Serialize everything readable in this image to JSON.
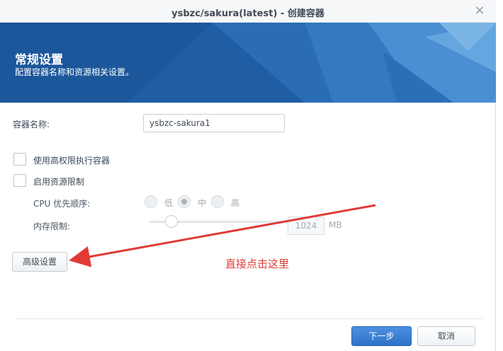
{
  "window": {
    "title": "ysbzc/sakura(latest) - 创建容器",
    "close_glyph": "×"
  },
  "banner": {
    "title": "常规设置",
    "subtitle": "配置容器名称和资源相关设置。"
  },
  "form": {
    "container_name_label": "容器名称:",
    "container_name_value": "ysbzc-sakura1",
    "privileged_label": "使用高权限执行容器",
    "privileged_checked": false,
    "resource_limit_label": "启用资源限制",
    "resource_limit_checked": false,
    "cpu_priority_label": "CPU 优先顺序:",
    "cpu_options": [
      "低",
      "中",
      "高"
    ],
    "cpu_selected": "中",
    "memory_limit_label": "内存限制:",
    "memory_value": "1024",
    "memory_unit": "MB"
  },
  "buttons": {
    "advanced": "高级设置",
    "next": "下一步",
    "cancel": "取消"
  },
  "annotation": {
    "text": "直接点击这里",
    "color": "#e03b36"
  },
  "colors": {
    "banner": "#1f5fa6",
    "primary_button": "#2d72c8"
  }
}
